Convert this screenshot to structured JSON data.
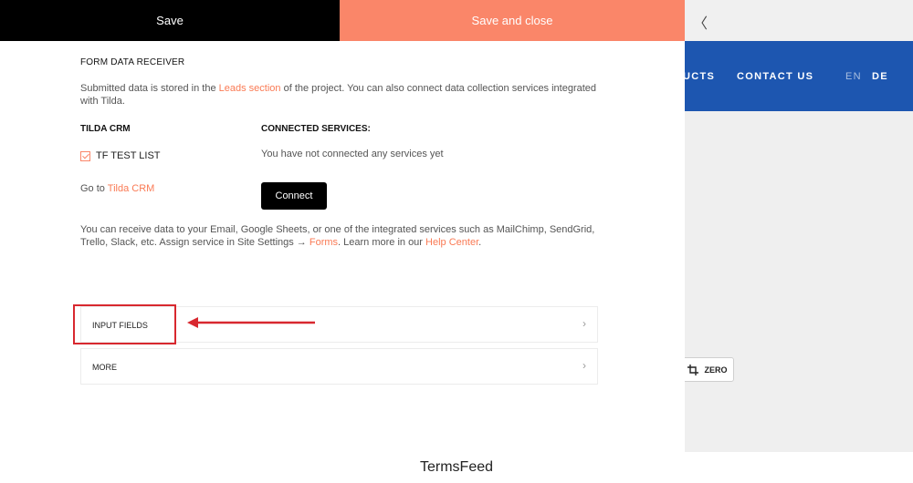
{
  "toolbar": {
    "save_label": "Save",
    "save_close_label": "Save and close"
  },
  "background": {
    "back_glyph": "〈",
    "nav_items": [
      "UCTS",
      "CONTACT US"
    ],
    "lang_en": "EN",
    "lang_de": "DE",
    "zero_label": "ZERO",
    "nav_color": "#1d56b0"
  },
  "form": {
    "title": "FORM DATA RECEIVER",
    "desc_pre": "Submitted data is stored in the ",
    "desc_link": "Leads section",
    "desc_post": " of the project. You can also connect data collection services integrated with Tilda.",
    "crm_heading": "TILDA CRM",
    "services_heading": "CONNECTED SERVICES:",
    "checkbox_label": "TF TEST LIST",
    "no_services": "You have not connected any services yet",
    "goto_pre": "Go to ",
    "goto_link": "Tilda CRM",
    "connect_label": "Connect",
    "info_pre": "You can receive data to your Email, Google Sheets, or one of the integrated services such as MailChimp, SendGrid, Trello, Slack, etc. Assign service in Site Settings → ",
    "info_link1": "Forms",
    "info_mid": ". Learn more in our ",
    "info_link2": "Help Center",
    "info_post": ".",
    "accent": "#fa8669"
  },
  "accordion": [
    {
      "label": "INPUT FIELDS"
    },
    {
      "label": "MORE"
    }
  ],
  "annotation": {
    "color": "#d8282f"
  },
  "footer": {
    "text": "TermsFeed"
  }
}
